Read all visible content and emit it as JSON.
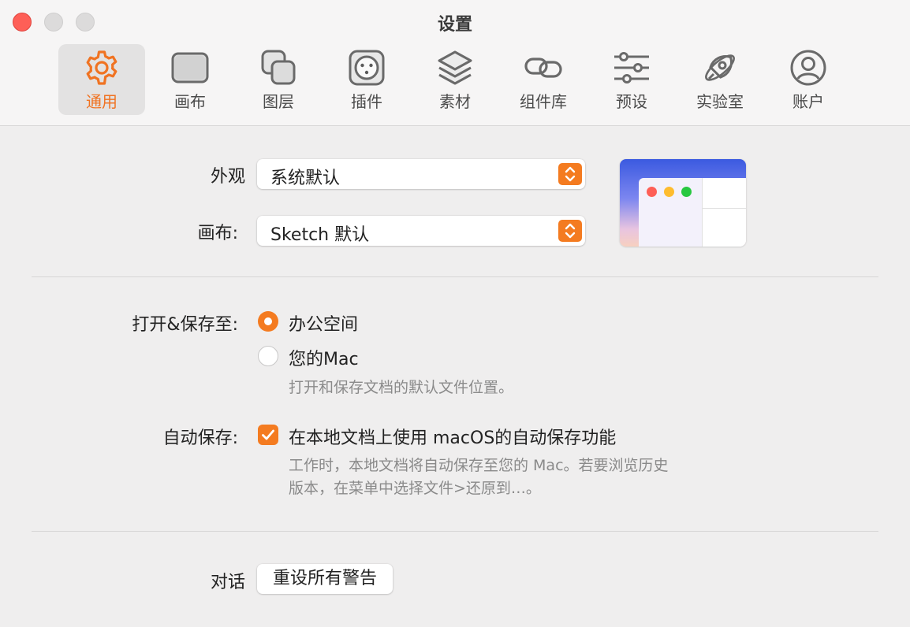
{
  "window": {
    "title": "设置"
  },
  "tabs": [
    {
      "label": "通用",
      "icon": "gear-icon",
      "active": true
    },
    {
      "label": "画布",
      "icon": "canvas-icon",
      "active": false
    },
    {
      "label": "图层",
      "icon": "layers-square-icon",
      "active": false
    },
    {
      "label": "插件",
      "icon": "plug-icon",
      "active": false
    },
    {
      "label": "素材",
      "icon": "stack-icon",
      "active": false
    },
    {
      "label": "组件库",
      "icon": "link-icon",
      "active": false
    },
    {
      "label": "预设",
      "icon": "sliders-icon",
      "active": false
    },
    {
      "label": "实验室",
      "icon": "rocket-icon",
      "active": false
    },
    {
      "label": "账户",
      "icon": "user-icon",
      "active": false
    }
  ],
  "appearance": {
    "label": "外观",
    "value": "系统默认"
  },
  "canvas": {
    "label": "画布:",
    "value": "Sketch 默认"
  },
  "open_save": {
    "label": "打开&保存至:",
    "options": [
      {
        "label": "办公空间",
        "selected": true
      },
      {
        "label": "您的Mac",
        "selected": false
      }
    ],
    "hint": "打开和保存文档的默认文件位置。"
  },
  "autosave": {
    "label": "自动保存:",
    "checkbox_label": "在本地文档上使用 macOS的自动保存功能",
    "checked": true,
    "hint_line1": "工作时，本地文档将自动保存至您的 Mac。若要浏览历史",
    "hint_line2": "版本，在菜单中选择文件>还原到…。"
  },
  "dialog": {
    "label": "对话",
    "button_label": "重设所有警告"
  },
  "colors": {
    "accent": "#f47b20",
    "close": "#fe5f57",
    "preview_yellow": "#febc2e",
    "preview_green": "#28c840"
  }
}
